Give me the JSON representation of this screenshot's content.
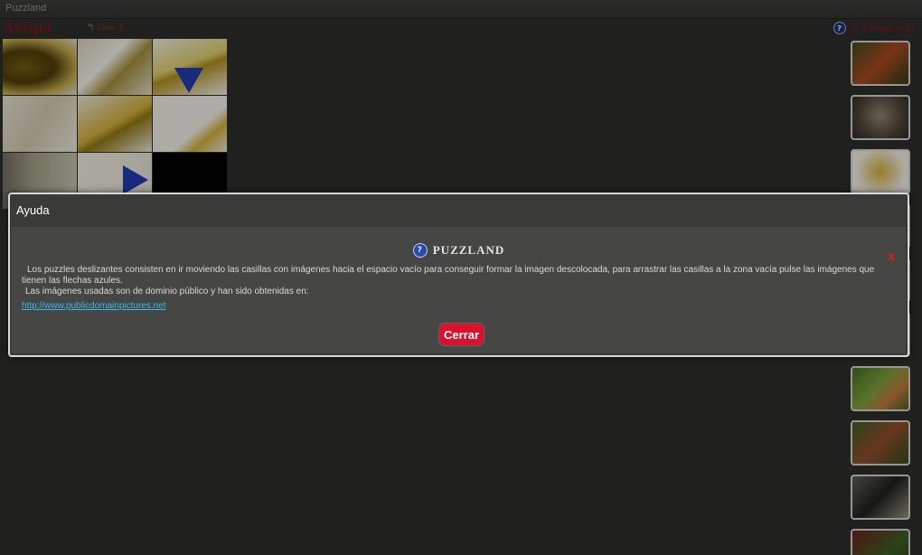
{
  "window": {
    "title": "Puzzland"
  },
  "header": {
    "puzzle_name": "Avispa",
    "moves_label": "Mov. 1",
    "timer_label": "Tiempo 0:01"
  },
  "board": {
    "tiles": [
      "image",
      "image",
      "arrow-down",
      "image",
      "image",
      "image",
      "image",
      "arrow-right",
      "empty"
    ]
  },
  "thumbnails": {
    "count": 10
  },
  "dialog": {
    "title": "Ayuda",
    "app_name": "PUZZLAND",
    "paragraph_1": "Los puzzles deslizantes consisten en ir moviendo las casillas con imágenes hacia el espacio vacío para conseguir formar la imagen descolocada, para arrastrar las casillas a la zona vacía pulse las imágenes que tienen las flechas azules.",
    "paragraph_2": "Las imágenes usadas son de dominio público y han sido obtenidas en:",
    "link": "http://www.publicdomainpictures.net",
    "close_label": "Cerrar",
    "close_x": "x"
  },
  "colors": {
    "accent_red": "#d9112b",
    "arrow_blue": "#1f3aa8",
    "link_blue": "#38b8e8"
  },
  "icons": {
    "help": "help-icon",
    "clock": "clock-icon",
    "close": "close-icon"
  }
}
